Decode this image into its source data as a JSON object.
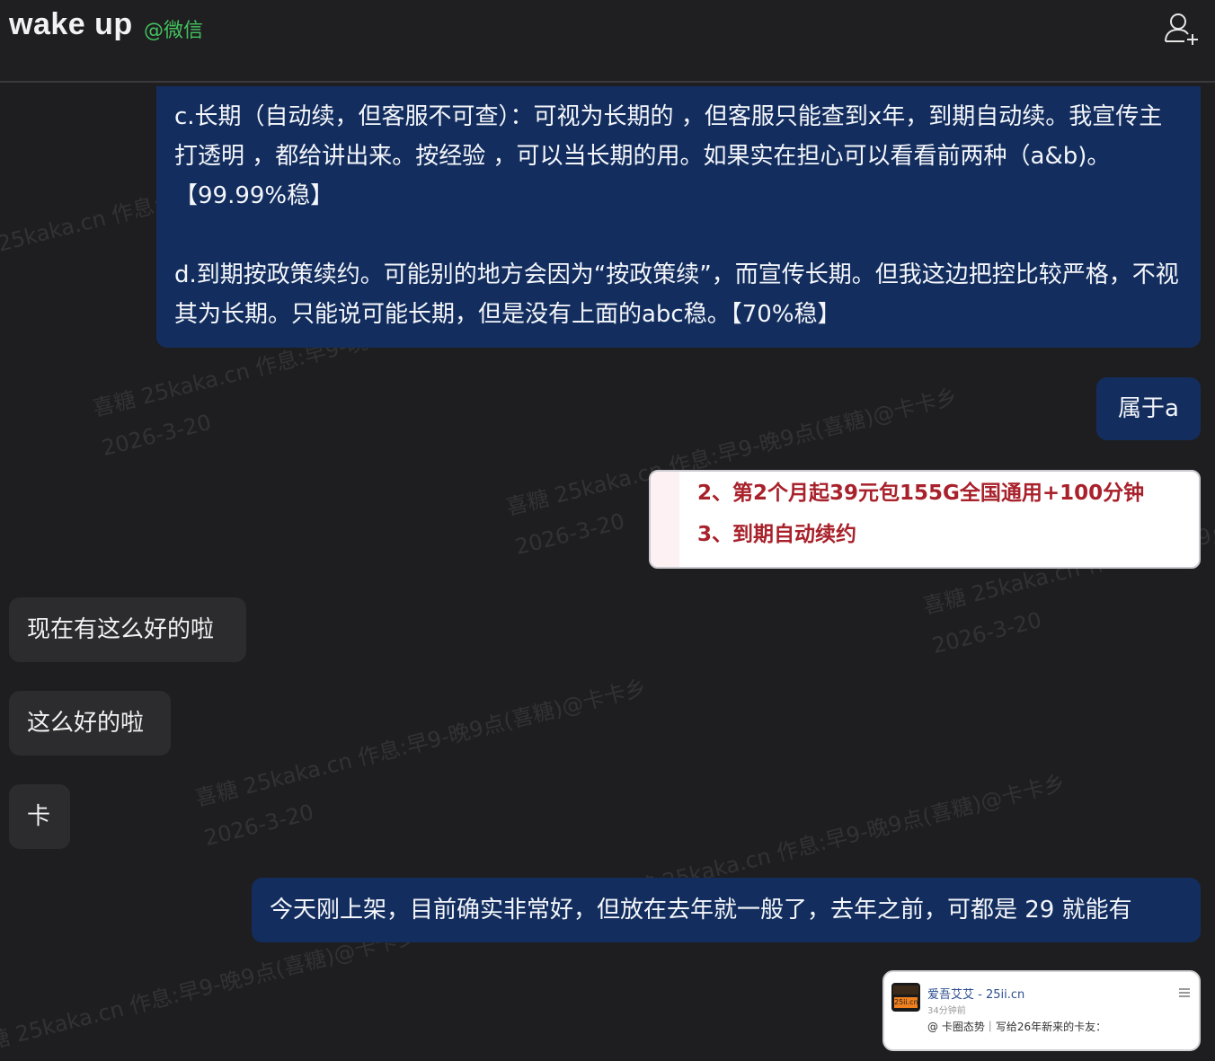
{
  "header": {
    "title": "wake up",
    "source_tag": "@微信"
  },
  "messages": {
    "m1_text": "c.长期（自动续，但客服不可查）：可视为长期的 ，但客服只能查到x年，到期自动续。我宣传主打透明 ，都给讲出来。按经验 ，可以当长期的用。如果实在担心可以看看前两种（a&b)。【99.99%稳】\n\nd.到期按政策续约。可能别的地方会因为“按政策续”，而宣传长期。但我这边把控比较严格，不视其为长期。只能说可能长期，但是没有上面的abc稳。【70%稳】",
    "m2_text": "属于a",
    "m3_image": {
      "line1": "2、第2个月起39元包155G全国通用+100分钟",
      "line2": "3、到期自动续约"
    },
    "m4_text": "现在有这么好的啦",
    "m5_text": "这么好的啦",
    "m6_text": "卡",
    "m7_text": "今天刚上架，目前确实非常好，但放在去年就一般了，去年之前，可都是 29 就能有",
    "m8_link": {
      "logo_text": "25ii.cn",
      "site": "爱吾艾艾 - 25ii.cn",
      "time": "34分钟前",
      "snippet": "@ 卡圈态势｜写给26年新来的卡友："
    }
  },
  "watermark": {
    "line1": "喜糖 25kaka.cn 作息:早9-晚9点(喜糖)@卡卡乡",
    "line2": "2026-3-20"
  },
  "colors": {
    "background": "#1e1e20",
    "outgoing_bubble": "#132e5e",
    "incoming_bubble": "#2c2c2e",
    "source_tag": "#43c15e",
    "image_text": "#a8212b"
  },
  "icons": {
    "add_contact": "add-contact-icon",
    "card_menu": "menu-icon"
  }
}
